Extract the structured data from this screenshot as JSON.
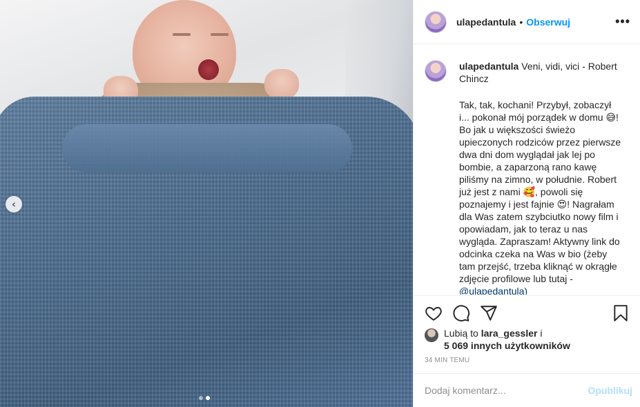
{
  "post": {
    "username": "ulapedantula",
    "separator": "•",
    "follow_label": "Obserwuj",
    "more_label": "•••",
    "caption_title": "Veni, vidi, vici - Robert Chincz",
    "caption_body": "Tak, tak, kochani! Przybył, zobaczył i... pokonał mój porządek w domu 😅! Bo jak u większości świeżo upieczonych rodziców przez pierwsze dwa dni dom wyglądał jak lej po bombie, a zaparzoną rano kawę piliśmy na zimno, w południe. Robert już jest z nami 🥰, powoli się poznajemy i jest fajnie 😍! Nagrałam dla Was zatem szybciutko nowy film i opowiadam, jak to teraz u nas wygląda. Zapraszam! Aktywny link do odcinka czeka na Was w bio (żeby tam przejść, trzeba kliknąć w okrągłe zdjęcie profilowe lub tutaj -",
    "caption_mention": "@ulapedantula)",
    "likes_prefix": "Lubią to",
    "likes_user": "lara_gessler",
    "likes_and": "i",
    "likes_others": "5 069 innych użytkowników",
    "timestamp": "34 MIN TEMU",
    "comment_placeholder": "Dodaj komentarz...",
    "publish_label": "Opublikuj"
  },
  "carousel": {
    "prev_label": "‹",
    "total_slides": 2,
    "active_slide": 2
  },
  "icons": {
    "like": "heart-icon",
    "comment": "comment-icon",
    "share": "share-icon",
    "save": "bookmark-icon"
  },
  "colors": {
    "accent": "#0095f6",
    "publish_disabled": "#b2dffc",
    "muted": "#8e8e8e",
    "text": "#262626"
  }
}
